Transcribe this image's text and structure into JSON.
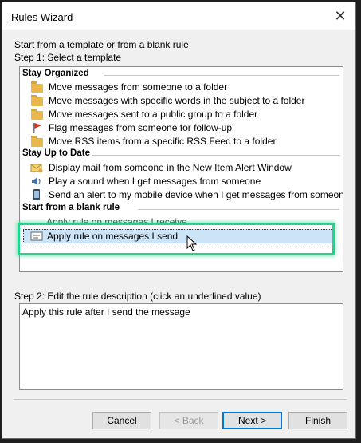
{
  "window": {
    "title": "Rules Wizard"
  },
  "intro": "Start from a template or from a blank rule",
  "step1_label": "Step 1: Select a template",
  "groups": {
    "organized": "Stay Organized",
    "uptodate": "Stay Up to Date",
    "blank": "Start from a blank rule"
  },
  "templates": {
    "t1": "Move messages from someone to a folder",
    "t2": "Move messages with specific words in the subject to a folder",
    "t3": "Move messages sent to a public group to a folder",
    "t4": "Flag messages from someone for follow-up",
    "t5": "Move RSS items from a specific RSS Feed to a folder",
    "t6": "Display mail from someone in the New Item Alert Window",
    "t7": "Play a sound when I get messages from someone",
    "t8": "Send an alert to my mobile device when I get messages from someone",
    "t9": "Apply rule on messages I receive",
    "t10": "Apply rule on messages I send"
  },
  "step2_label": "Step 2: Edit the rule description (click an underlined value)",
  "description": "Apply this rule after I send the message",
  "buttons": {
    "cancel": "Cancel",
    "back": "< Back",
    "next": "Next >",
    "finish": "Finish"
  },
  "colors": {
    "highlight": "#22d38a",
    "selection": "#cce4f7"
  }
}
